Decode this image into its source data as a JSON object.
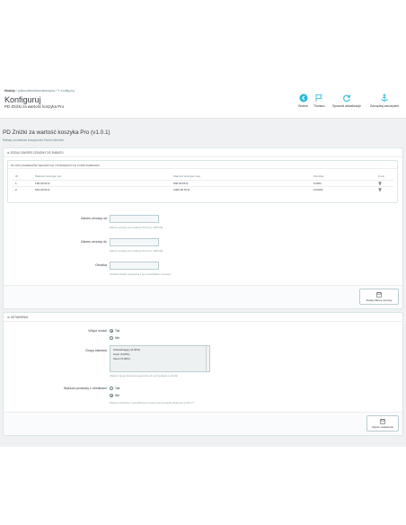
{
  "header": {
    "breadcrumb": [
      "Moduły",
      "pdstosniemiabcesskoszyka",
      "Konfiguruj"
    ],
    "title": "Konfiguruj",
    "subtitle": "PD Zniżki za wartość koszyka Pro",
    "toolbar": [
      {
        "label": "Wstecz",
        "icon": "back-icon"
      },
      {
        "label": "Tłumacz",
        "icon": "flag-icon"
      },
      {
        "label": "Sprawdź aktualizacje",
        "icon": "refresh-icon"
      },
      {
        "label": "Zarządzaj zaczepami",
        "icon": "anchor-icon"
      }
    ]
  },
  "module": {
    "title": "PD Zniżki za wartość koszyka Pro (v1.0.1)",
    "description": "Rabaty od wartości koszyka dla Twoich klientów"
  },
  "range_panel": {
    "heading": "Dodaj zakres cenowy do rabatu",
    "list_heading": "Lista zakresów cenowych i powiązanych z nimi rabatami",
    "columns": [
      "ID",
      "Wartość koszyka min.",
      "Wartość koszyka max.",
      "Obniżka",
      "Usuń"
    ],
    "rows": [
      {
        "id": "1",
        "min": "100.00 PLN",
        "max": "500.00 PLN",
        "discount": "5.00%"
      },
      {
        "id": "2",
        "min": "501.00 PLN",
        "max": "1000.00 PLN",
        "discount": "10.00%"
      }
    ],
    "fields": {
      "from_label": "Zakres cenowy od",
      "from_help": "Zakres cenowy od w walucie PLN (np. 1000.00)",
      "to_label": "Zakres cenowy do",
      "to_help": "Zakres cenowy do w walucie PLN (np. 1000.00)",
      "discount_label": "Obniżka",
      "discount_help": "Obniżka będzie niezgodna z tym przedziałem cenowym"
    },
    "add_button": "Dodaj zakres cenowy"
  },
  "settings_panel": {
    "heading": "Ustawienia",
    "enable_label": "Włącz moduł",
    "yes": "Tak",
    "no": "Nie",
    "groups_label": "Grupy klientów",
    "groups": [
      "Odwiedzający (0.00%)",
      "Gość (0.00%)",
      "Klient (0.00%)"
    ],
    "groups_help": "Wybierz grupy klientów uprawnione do skorzystania z obniżki",
    "exclude_label": "Wyklucz produkty z obniżkami",
    "exclude_help": "Wyklucz produkty z specyficznymi cenami (promocjami) dodanymi w PS 1.7",
    "save_button": "Zapisz ustawienia"
  },
  "colors": {
    "accent": "#25b9d7",
    "background": "#eff1f2"
  }
}
